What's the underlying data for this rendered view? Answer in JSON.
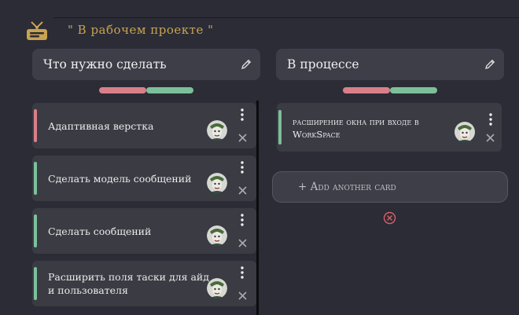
{
  "project": {
    "title": "\" В рабочем проекте \""
  },
  "columns": [
    {
      "title": "Что нужно сделать",
      "cards": [
        {
          "text": "Адаптивная верстка",
          "stripe": "#d97f89"
        },
        {
          "text": "Сделать модель сообщений",
          "stripe": "#7cc09a"
        },
        {
          "text": "Сделать сообщений",
          "stripe": "#7cc09a"
        },
        {
          "text": "Расширить поля таски для айд и пользователя",
          "stripe": "#7cc09a"
        }
      ]
    },
    {
      "title": "В процессе",
      "cards": [
        {
          "text": "расширение окна при входе в WorkSpace",
          "stripe": "#7cc09a"
        }
      ],
      "add_card_label": "+ Add another card"
    }
  ],
  "colors": {
    "accent_gold": "#c9a352",
    "label_red": "#d97f89",
    "label_green": "#7cc09a",
    "cancel_red": "#d9606a",
    "background": "#2b2c35"
  },
  "icons": [
    "tavern-sign-icon",
    "pencil-edit-icon",
    "kebab-menu-icon",
    "close-icon",
    "cancel-circle-icon",
    "user-avatar"
  ]
}
